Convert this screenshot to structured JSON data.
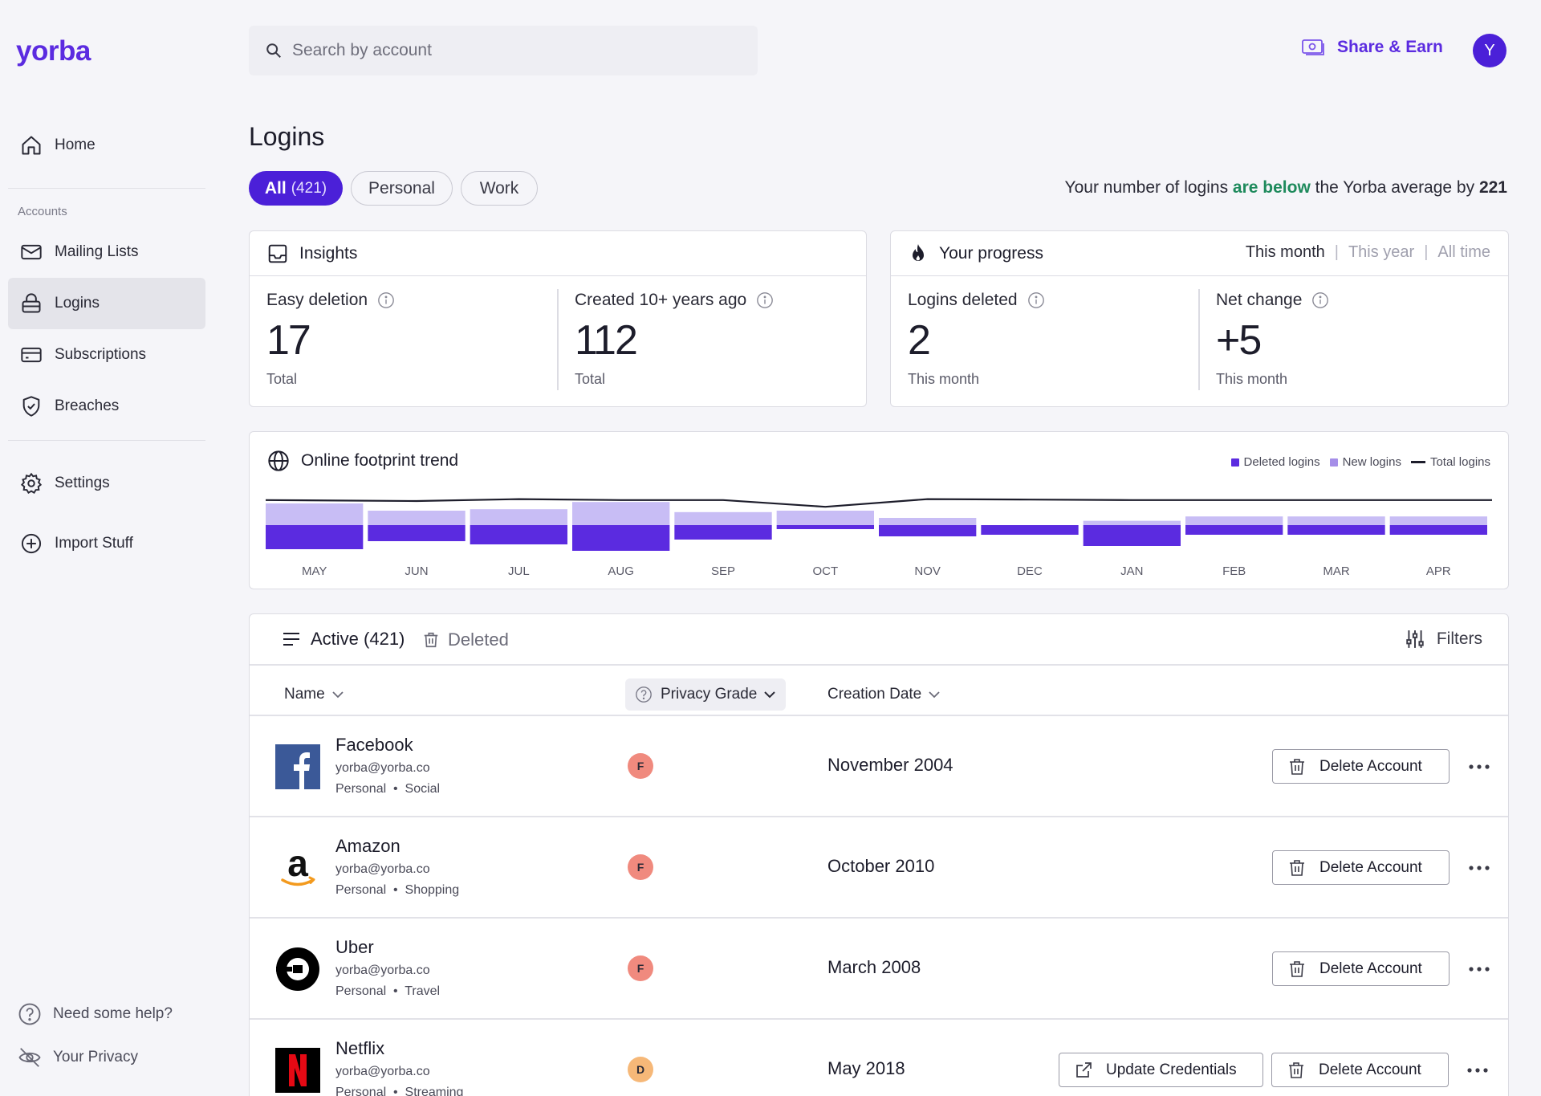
{
  "app": {
    "logo": "yorba"
  },
  "sidebar": {
    "home": "Home",
    "accounts_label": "Accounts",
    "items": [
      {
        "label": "Mailing Lists",
        "icon": "mail-icon"
      },
      {
        "label": "Logins",
        "icon": "lock-icon",
        "active": true
      },
      {
        "label": "Subscriptions",
        "icon": "card-icon"
      },
      {
        "label": "Breaches",
        "icon": "shield-icon"
      }
    ],
    "settings": "Settings",
    "import": "Import Stuff",
    "help": "Need some help?",
    "privacy": "Your Privacy"
  },
  "topbar": {
    "search_placeholder": "Search by account",
    "share_label": "Share & Earn",
    "avatar_initial": "Y"
  },
  "page": {
    "title": "Logins",
    "filters": {
      "all": "All",
      "all_count": "(421)",
      "personal": "Personal",
      "work": "Work"
    },
    "avg_note": {
      "pre": "Your number of logins ",
      "hl": "are below",
      "mid": " the Yorba average by ",
      "num": "221"
    }
  },
  "insights": {
    "title": "Insights",
    "stats": [
      {
        "label": "Easy deletion",
        "value": "17",
        "sub": "Total"
      },
      {
        "label": "Created 10+ years ago",
        "value": "112",
        "sub": "Total"
      }
    ]
  },
  "progress": {
    "title": "Your progress",
    "ranges": [
      "This month",
      "This year",
      "All time"
    ],
    "selected_range": "This month",
    "stats": [
      {
        "label": "Logins deleted",
        "value": "2",
        "sub": "This month"
      },
      {
        "label": "Net change",
        "value": "+5",
        "sub": "This month"
      }
    ]
  },
  "trend": {
    "title": "Online footprint trend",
    "legend": {
      "deleted": "Deleted logins",
      "new": "New logins",
      "total": "Total logins"
    }
  },
  "colors": {
    "accent": "#4b20d8",
    "deleted": "#5b2be0",
    "new": "#c8bdf5",
    "positive": "#1e8a5c",
    "grade_f": "#f08a7e",
    "grade_d": "#f6b878"
  },
  "chart_data": {
    "type": "bar",
    "categories": [
      "MAY",
      "JUN",
      "JUL",
      "AUG",
      "SEP",
      "OCT",
      "NOV",
      "DEC",
      "JAN",
      "FEB",
      "MAR",
      "APR"
    ],
    "series": [
      {
        "name": "Deleted logins",
        "values": [
          30,
          20,
          24,
          32,
          18,
          5,
          14,
          12,
          26,
          12,
          12,
          12
        ]
      },
      {
        "name": "New logins",
        "values": [
          30,
          20,
          22,
          32,
          18,
          20,
          10,
          0,
          6,
          12,
          12,
          12
        ]
      },
      {
        "name": "Total logins",
        "values": [
          52,
          50,
          54,
          52,
          52,
          38,
          54,
          53,
          52,
          52,
          52,
          52
        ]
      }
    ],
    "legend": "top-right",
    "grid": false
  },
  "table": {
    "tab_active": "Active (421)",
    "tab_deleted": "Deleted",
    "filters_label": "Filters",
    "columns": {
      "name": "Name",
      "privacy": "Privacy Grade",
      "date": "Creation Date"
    },
    "delete_label": "Delete Account",
    "update_label": "Update Credentials",
    "rows": [
      {
        "name": "Facebook",
        "email": "yorba@yorba.co",
        "tags": "Personal  •  Social",
        "grade": "F",
        "date": "November 2004",
        "logo": "facebook-logo",
        "update": false
      },
      {
        "name": "Amazon",
        "email": "yorba@yorba.co",
        "tags": "Personal  •  Shopping",
        "grade": "F",
        "date": "October 2010",
        "logo": "amazon-logo",
        "update": false
      },
      {
        "name": "Uber",
        "email": "yorba@yorba.co",
        "tags": "Personal  •  Travel",
        "grade": "F",
        "date": "March 2008",
        "logo": "uber-logo",
        "update": false
      },
      {
        "name": "Netflix",
        "email": "yorba@yorba.co",
        "tags": "Personal  •  Streaming",
        "grade": "D",
        "date": "May 2018",
        "logo": "netflix-logo",
        "update": true
      }
    ]
  }
}
